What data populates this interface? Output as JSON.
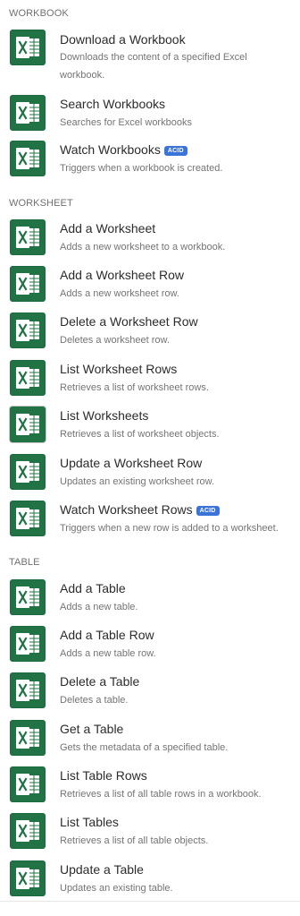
{
  "sections": [
    {
      "header": "WORKBOOK",
      "items": [
        {
          "title": "Download a Workbook",
          "description": "Downloads the content of a specified Excel workbook.",
          "icon": "excel-icon"
        },
        {
          "title": "Search Workbooks",
          "description": "Searches for Excel workbooks",
          "icon": "excel-icon"
        },
        {
          "title": "Watch Workbooks",
          "description": "Triggers when a workbook is created.",
          "badge": "ACID",
          "icon": "excel-icon"
        }
      ]
    },
    {
      "header": "WORKSHEET",
      "items": [
        {
          "title": "Add a Worksheet",
          "description": "Adds a new worksheet to a workbook.",
          "icon": "excel-icon"
        },
        {
          "title": "Add a Worksheet Row",
          "description": "Adds a new worksheet row.",
          "icon": "excel-icon"
        },
        {
          "title": "Delete a Worksheet Row",
          "description": "Deletes a worksheet row.",
          "icon": "excel-icon"
        },
        {
          "title": "List Worksheet Rows",
          "description": "Retrieves a list of worksheet rows.",
          "icon": "excel-icon"
        },
        {
          "title": "List Worksheets",
          "description": "Retrieves a list of worksheet objects.",
          "icon": "excel-icon"
        },
        {
          "title": "Update a Worksheet Row",
          "description": "Updates an existing worksheet row.",
          "icon": "excel-icon"
        },
        {
          "title": "Watch Worksheet Rows",
          "description": "Triggers when a new row is added to a worksheet.",
          "badge": "ACID",
          "icon": "excel-icon"
        }
      ]
    },
    {
      "header": "TABLE",
      "items": [
        {
          "title": "Add a Table",
          "description": "Adds a new table.",
          "icon": "excel-icon"
        },
        {
          "title": "Add a Table Row",
          "description": "Adds a new table row.",
          "icon": "excel-icon"
        },
        {
          "title": "Delete a Table",
          "description": "Deletes a table.",
          "icon": "excel-icon"
        },
        {
          "title": "Get a Table",
          "description": "Gets the metadata of a specified table.",
          "icon": "excel-icon"
        },
        {
          "title": "List Table Rows",
          "description": "Retrieves a list of all table rows in a workbook.",
          "icon": "excel-icon"
        },
        {
          "title": "List Tables",
          "description": "Retrieves a list of all table objects.",
          "icon": "excel-icon"
        },
        {
          "title": "Update a Table",
          "description": "Updates an existing table.",
          "icon": "excel-icon"
        }
      ]
    }
  ],
  "colors": {
    "icon_bg": "#217346",
    "badge_bg": "#3b74d9",
    "title_text": "#2c2c2c",
    "description_text": "#747474",
    "section_header_text": "#707070"
  }
}
